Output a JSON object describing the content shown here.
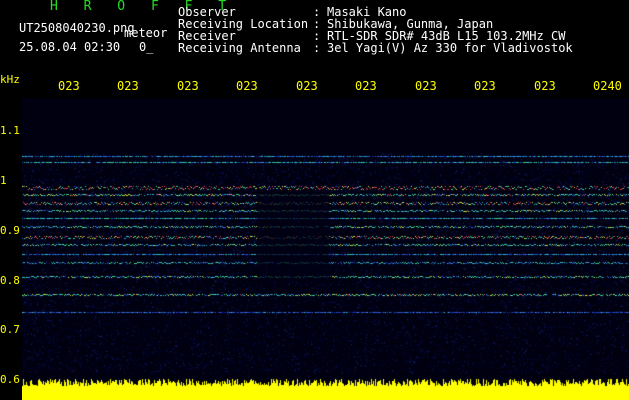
{
  "header": {
    "app_name": "H R O F F T",
    "filename": "UT2508040230.png",
    "mode": "meteor",
    "datetime": "25.08.04 02:30",
    "count": "0_",
    "info": [
      {
        "label": "Observer",
        "sep": ":",
        "value": "Masaki Kano"
      },
      {
        "label": "Receiving Location",
        "sep": ":",
        "value": "Shibukawa, Gunma, Japan"
      },
      {
        "label": "Receiver",
        "sep": ":",
        "value": "RTL-SDR SDR# 43dB L15 103.2MHz CW"
      },
      {
        "label": "Receiving Antenna",
        "sep": ":",
        "value": "3el Yagi(V) Az 330 for Vladivostok"
      }
    ]
  },
  "axes": {
    "y_unit": "kHz",
    "y_ticks": [
      "1.1",
      "1",
      "0.9",
      "0.8",
      "0.7",
      "0.6"
    ],
    "x_ticks": [
      "023",
      "023",
      "023",
      "023",
      "023",
      "023",
      "023",
      "023",
      "023",
      "0240"
    ]
  },
  "colors": {
    "background": "#000000",
    "axis_text": "#ffff00",
    "header_text": "#ffffff",
    "title_green": "#22e022"
  }
}
